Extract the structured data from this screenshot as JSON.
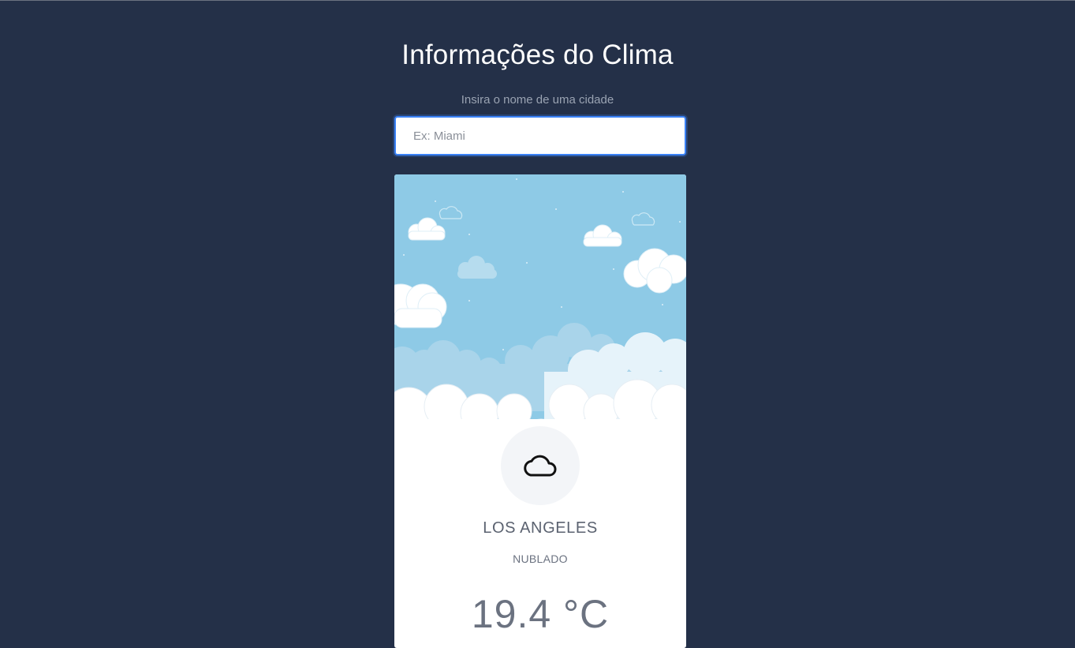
{
  "page": {
    "title": "Informações do Clima"
  },
  "search": {
    "label": "Insira o nome de uma cidade",
    "placeholder": "Ex: Miami",
    "value": ""
  },
  "weather": {
    "icon": "cloud-icon",
    "city": "LOS ANGELES",
    "description": "NUBLADO",
    "temperature": "19.4 °C"
  },
  "colors": {
    "background": "#243048",
    "accent": "#3b82f6",
    "sky": "#8ecae6"
  }
}
